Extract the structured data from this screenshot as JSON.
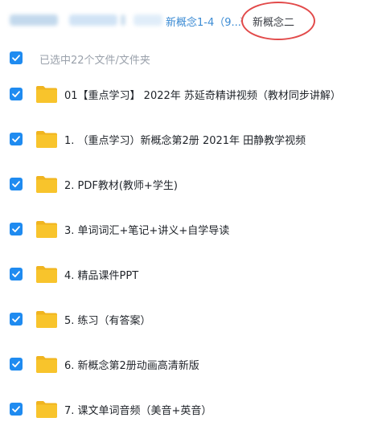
{
  "breadcrumb": {
    "parent_folder": "新概念1-4（9...",
    "separator": "›",
    "current_folder": "新概念二"
  },
  "selection": {
    "status_text": "已选中22个文件/文件夹"
  },
  "files": [
    {
      "name": "01【重点学习】 2022年 苏延奇精讲视频（教材同步讲解）",
      "checked": true
    },
    {
      "name": "1. （重点学习）新概念第2册 2021年 田静教学视频",
      "checked": true
    },
    {
      "name": "2. PDF教材(教师+学生)",
      "checked": true
    },
    {
      "name": "3. 单词词汇+笔记+讲义+自学导读",
      "checked": true
    },
    {
      "name": "4. 精品课件PPT",
      "checked": true
    },
    {
      "name": "5. 练习（有答案）",
      "checked": true
    },
    {
      "name": "6. 新概念第2册动画高清新版",
      "checked": true
    },
    {
      "name": "7. 课文单词音频（美音+英音）",
      "checked": true
    }
  ],
  "colors": {
    "accent": "#1f8bf0",
    "folder": "#f8c42c",
    "link": "#3b8bd4",
    "highlight_ring": "#e24a4a"
  },
  "icons": {
    "checkbox": "checkmark-icon",
    "folder": "folder-icon"
  }
}
